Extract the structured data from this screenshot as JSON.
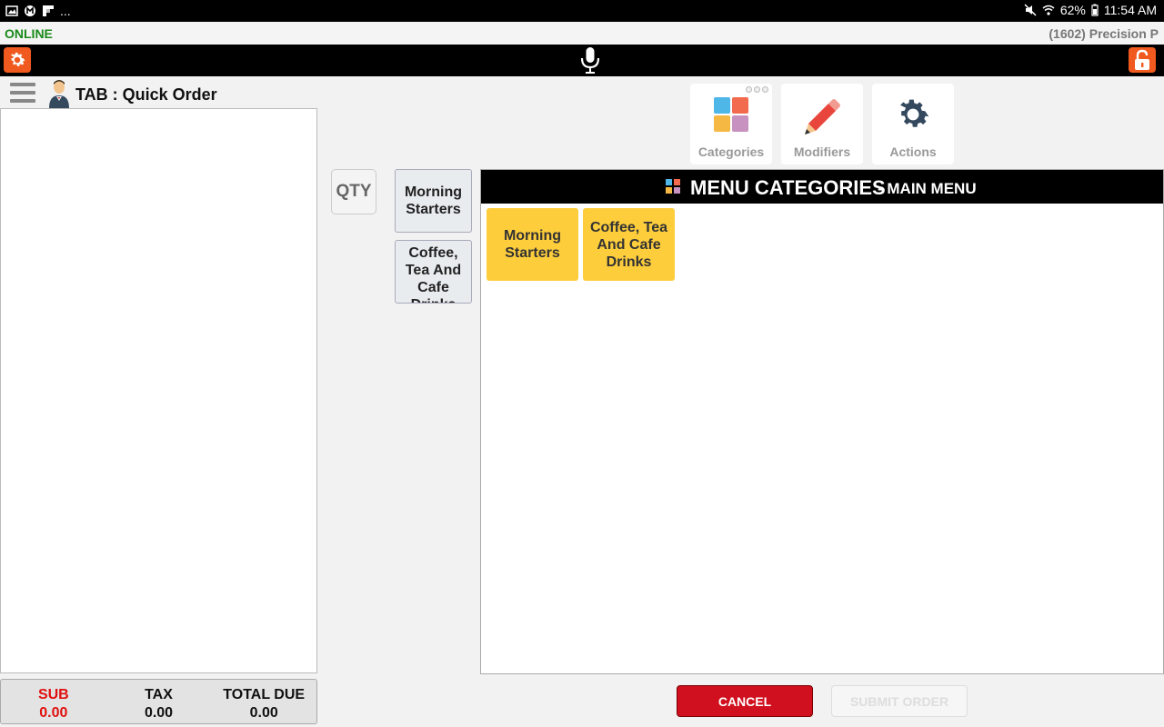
{
  "status_bar": {
    "left_ellipsis": "...",
    "battery": "62%",
    "time": "11:54 AM"
  },
  "connection": {
    "status": "ONLINE",
    "status_color": "#1a8a1a",
    "store_label": "(1602) Precision P"
  },
  "tab": {
    "title": "TAB : Quick Order"
  },
  "tiles": {
    "categories": "Categories",
    "modifiers": "Modifiers",
    "actions": "Actions"
  },
  "qty_label": "QTY",
  "side_categories": [
    "Morning Starters",
    "Coffee, Tea And Cafe Drinks"
  ],
  "menu": {
    "title": "MENU CATEGORIES",
    "subtitle": "- MAIN MENU",
    "categories": [
      "Morning Starters",
      "Coffee, Tea And Cafe Drinks"
    ]
  },
  "totals": {
    "sub_label": "SUB",
    "sub_value": "0.00",
    "tax_label": "TAX",
    "tax_value": "0.00",
    "due_label": "TOTAL DUE",
    "due_value": "0.00"
  },
  "buttons": {
    "cancel": "CANCEL",
    "submit": "SUBMIT ORDER"
  },
  "colors": {
    "accent_orange": "#f05a1e",
    "category_yellow": "#fdcd3c",
    "cancel_red": "#d0101e",
    "subtotal_red": "#e01010"
  }
}
